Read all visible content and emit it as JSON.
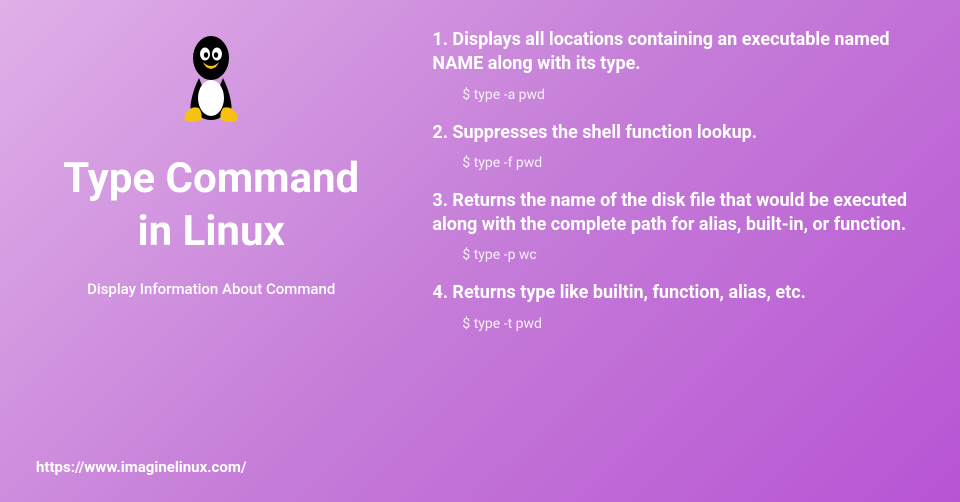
{
  "left": {
    "title_line1": "Type Command",
    "title_line2": "in Linux",
    "subtitle": "Display Information About Command"
  },
  "footer": {
    "url": "https://www.imaginelinux.com/"
  },
  "items": [
    {
      "heading": "1. Displays all locations containing an executable named NAME along with its type.",
      "command": "$ type -a pwd"
    },
    {
      "heading": "2. Suppresses the shell function lookup.",
      "command": "$ type -f pwd"
    },
    {
      "heading": "3. Returns the name of the disk file that would be executed along with the complete path for alias, built-in, or function.",
      "command": "$ type -p wc"
    },
    {
      "heading": "4. Returns type like builtin, function, alias, etc.",
      "command": "$ type -t pwd"
    }
  ]
}
